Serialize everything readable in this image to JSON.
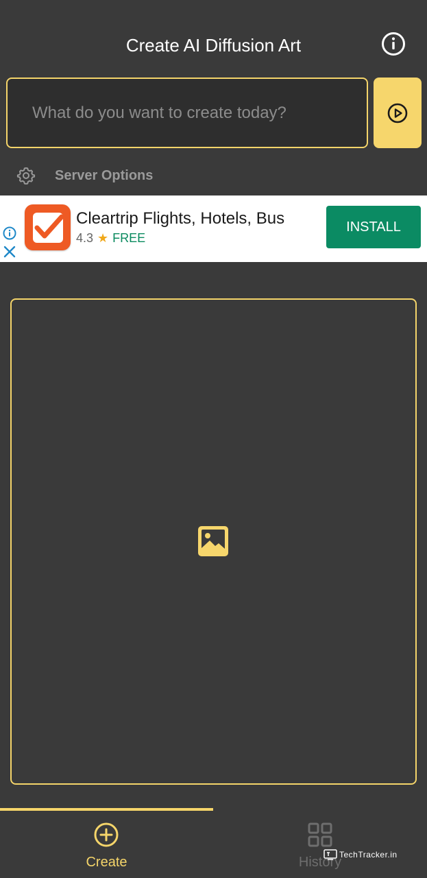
{
  "app": {
    "title": "Create AI Diffusion Art",
    "accent_color": "#f5d56a",
    "background_color": "#3a3a3a"
  },
  "header": {
    "info_icon": "info-circle-icon"
  },
  "prompt": {
    "placeholder": "What do you want to create today?",
    "value": "",
    "submit_icon": "play-circle-icon"
  },
  "server_options": {
    "label": "Server Options",
    "icon": "gear-icon"
  },
  "ad": {
    "app_name": "Cleartrip Flights, Hotels, Bus",
    "rating": "4.3",
    "star_icon": "★",
    "price": "FREE",
    "install_label": "INSTALL",
    "install_color": "#0b8b63"
  },
  "canvas": {
    "placeholder_icon": "image-icon"
  },
  "bottom_nav": {
    "items": [
      {
        "label": "Create",
        "icon": "plus-circle-icon",
        "active": true
      },
      {
        "label": "History",
        "icon": "grid-icon",
        "active": false
      }
    ]
  },
  "watermark": {
    "text": "TechTracker.in"
  }
}
